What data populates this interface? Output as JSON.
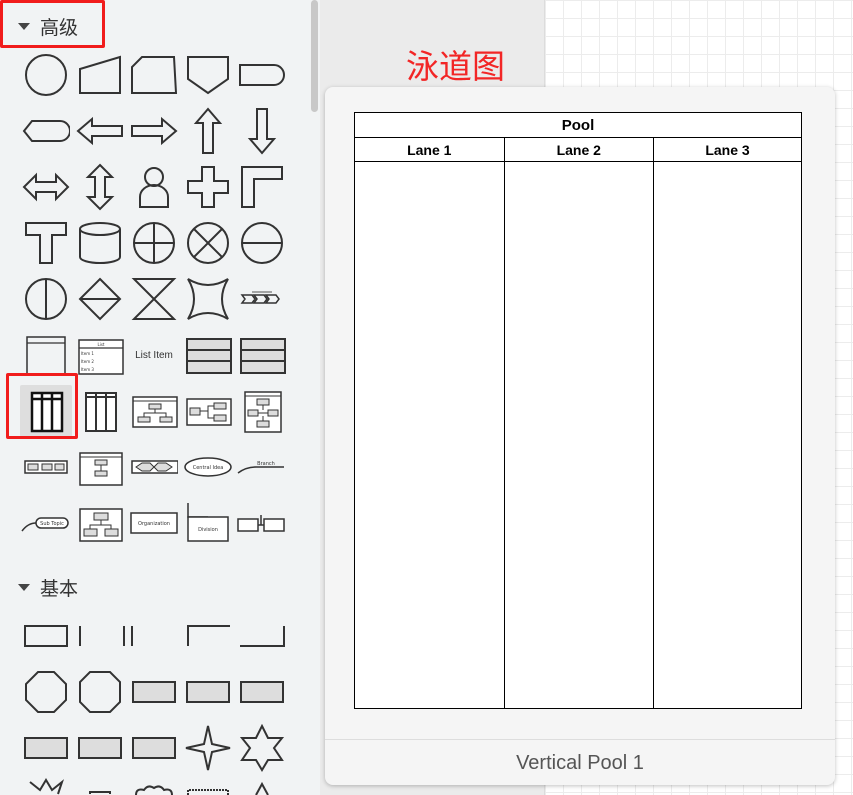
{
  "sidebar": {
    "advanced_section": {
      "title": "高级"
    },
    "basic_section": {
      "title": "基本"
    },
    "list_item_label": "List Item",
    "mindmap_labels": {
      "central_idea": "Central Idea",
      "branch": "Branch",
      "sub_topic": "Sub Topic",
      "organization": "Organization",
      "division": "Division"
    },
    "list_labels": {
      "header": "List",
      "item1": "Item 1",
      "item2": "Item 2",
      "item3": "Item 3"
    },
    "selected_shape": "vertical-pool-icon"
  },
  "annotation": {
    "text": "泳道图"
  },
  "tooltip": {
    "caption": "Vertical Pool 1",
    "pool": {
      "title": "Pool",
      "lanes": [
        "Lane 1",
        "Lane 2",
        "Lane 3"
      ]
    }
  },
  "colors": {
    "highlight": "#f11c1c",
    "annotation": "#f22626",
    "stroke": "#333333",
    "fill_gray": "#dddddd"
  }
}
